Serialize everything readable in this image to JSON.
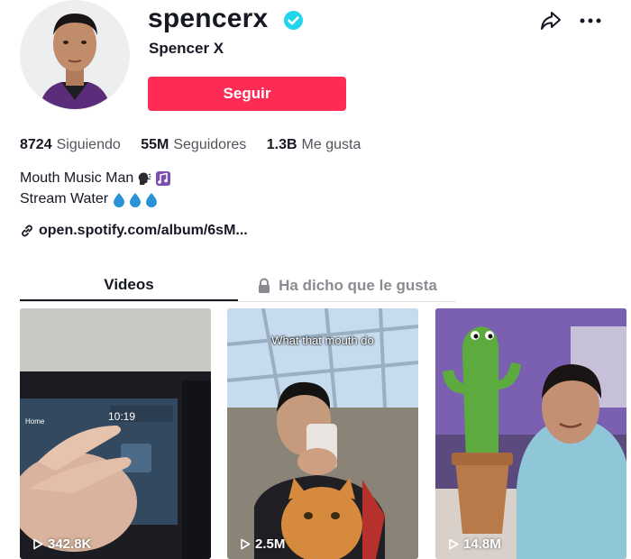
{
  "profile": {
    "username": "spencerx",
    "nickname": "Spencer X",
    "follow_label": "Seguir"
  },
  "stats": [
    {
      "value": "8724",
      "label": "Siguiendo"
    },
    {
      "value": "55M",
      "label": "Seguidores"
    },
    {
      "value": "1.3B",
      "label": "Me gusta"
    }
  ],
  "bio": {
    "line1": "Mouth Music Man",
    "line2": "Stream Water"
  },
  "link": {
    "text": "open.spotify.com/album/6sM..."
  },
  "tabs": {
    "videos": "Videos",
    "liked": "Ha dicho que le gusta"
  },
  "videos": [
    {
      "views": "342.8K",
      "caption": ""
    },
    {
      "views": "2.5M",
      "caption": "What that mouth do"
    },
    {
      "views": "14.8M",
      "caption": ""
    }
  ],
  "icons": {
    "verified": "verified-badge-icon",
    "share": "share-arrow-icon",
    "more": "more-dots-icon",
    "link": "link-chain-icon",
    "lock": "lock-icon",
    "play": "play-icon"
  },
  "colors": {
    "accent": "#fe2c55",
    "verified": "#20d5ec",
    "text": "#161823"
  }
}
